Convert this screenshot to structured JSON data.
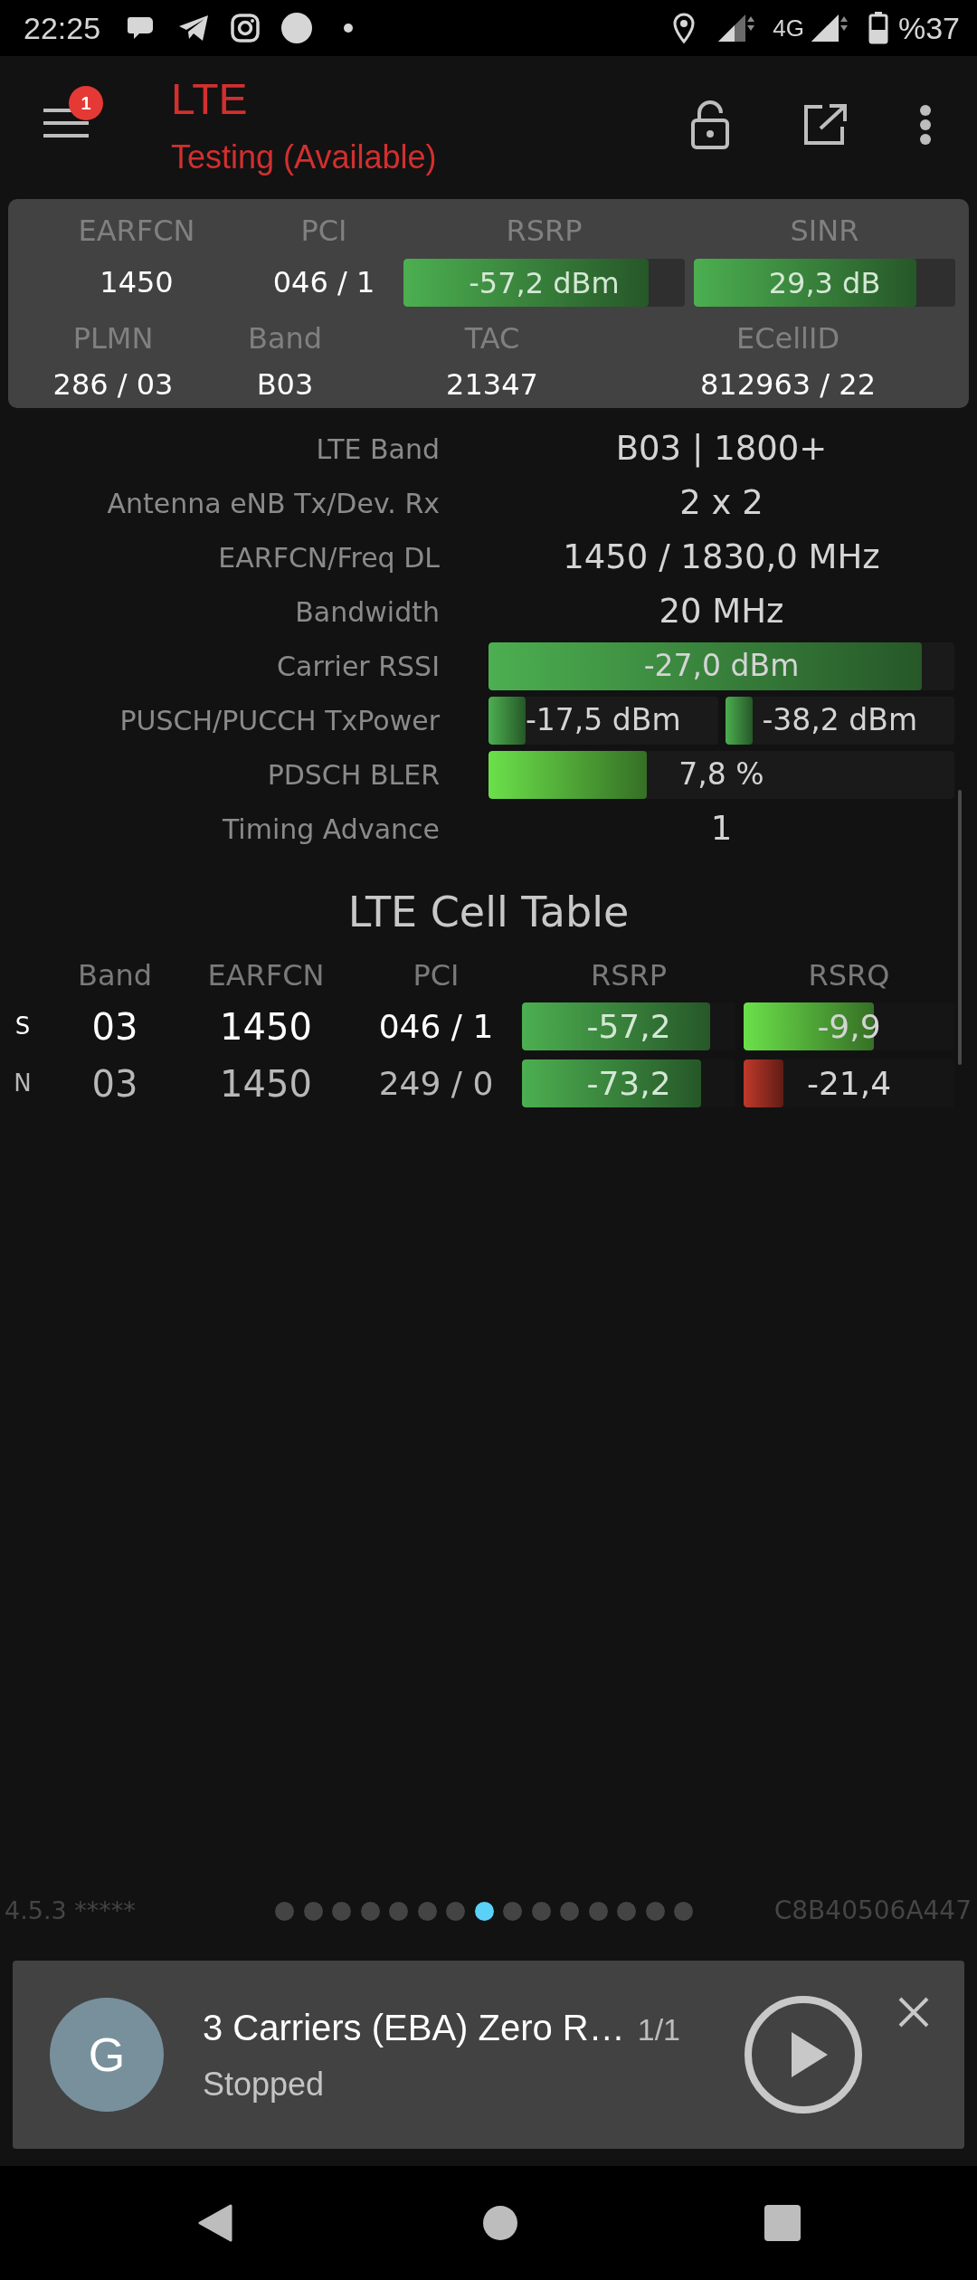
{
  "status_bar": {
    "time": "22:25",
    "network_type": "4G",
    "battery": "%37"
  },
  "app_bar": {
    "title": "LTE",
    "subtitle": "Testing (Available)",
    "menu_badge": "1"
  },
  "summary": {
    "row_1": [
      {
        "kind": "text",
        "label": "EARFCN",
        "value": "1450"
      },
      {
        "kind": "text",
        "label": "PCI",
        "value": "046 / 1"
      },
      {
        "kind": "bar",
        "label": "RSRP",
        "value": "-57,2 dBm",
        "level": 0.87,
        "color": "#4caf50"
      },
      {
        "kind": "bar",
        "label": "SINR",
        "value": "29,3 dB",
        "level": 0.85,
        "color": "#4caf50"
      }
    ],
    "row_2": [
      {
        "label": "PLMN",
        "value": "286 / 03"
      },
      {
        "label": "Band",
        "value": "B03"
      },
      {
        "label": "TAC",
        "value": "21347"
      },
      {
        "label": "ECellID",
        "value": "812963 / 22"
      }
    ]
  },
  "details": [
    {
      "kind": "text",
      "label": "LTE Band",
      "value": "B03 | 1800+"
    },
    {
      "kind": "text",
      "label": "Antenna eNB Tx/Dev. Rx",
      "value": "2 x 2"
    },
    {
      "kind": "text",
      "label": "EARFCN/Freq DL",
      "value": "1450 / 1830,0 MHz"
    },
    {
      "kind": "text",
      "label": "Bandwidth",
      "value": "20 MHz"
    },
    {
      "kind": "bars",
      "label": "Carrier RSSI",
      "bars": [
        {
          "value": "-27,0 dBm",
          "level": 0.93,
          "color": "#4caf50"
        }
      ]
    },
    {
      "kind": "bars",
      "label": "PUSCH/PUCCH TxPower",
      "bars": [
        {
          "value": "-17,5 dBm",
          "level": 0.16,
          "color": "#4caf50"
        },
        {
          "value": "-38,2 dBm",
          "level": 0.12,
          "color": "#4caf50"
        }
      ]
    },
    {
      "kind": "bars",
      "label": "PDSCH BLER",
      "bars": [
        {
          "value": "7,8 %",
          "level": 0.34,
          "color": "#6be04a"
        }
      ]
    },
    {
      "kind": "text",
      "label": "Timing Advance",
      "value": "1"
    }
  ],
  "cell_table": {
    "title": "LTE Cell Table",
    "columns": [
      "Band",
      "EARFCN",
      "PCI",
      "RSRP",
      "RSRQ"
    ],
    "rows": [
      {
        "type": "S",
        "serving": true,
        "band": "03",
        "earfcn": "1450",
        "pci": "046 / 1",
        "rsrp": {
          "value": "-57,2",
          "level": 0.88,
          "color": "#4caf50"
        },
        "rsrq": {
          "value": "-9,9",
          "level": 0.62,
          "color": "#6be04a"
        }
      },
      {
        "type": "N",
        "serving": false,
        "band": "03",
        "earfcn": "1450",
        "pci": "249 / 0",
        "rsrp": {
          "value": "-73,2",
          "level": 0.84,
          "color": "#4caf50"
        },
        "rsrq": {
          "value": "-21,4",
          "level": 0.19,
          "color": "#c0392b"
        }
      }
    ]
  },
  "footer": {
    "version": "4.5.3 *****",
    "device_id": "C8B40506A447"
  },
  "pager": {
    "dots": [
      {
        "selected": false
      },
      {
        "selected": false
      },
      {
        "selected": false
      },
      {
        "selected": false
      },
      {
        "selected": false
      },
      {
        "selected": false
      },
      {
        "selected": false
      },
      {
        "selected": true
      },
      {
        "selected": false
      },
      {
        "selected": false
      },
      {
        "selected": false
      },
      {
        "selected": false
      },
      {
        "selected": false
      },
      {
        "selected": false
      },
      {
        "selected": false
      }
    ]
  },
  "notification": {
    "avatar": "G",
    "title": "3 Carriers (EBA) Zero R…",
    "counter": "1/1",
    "status": "Stopped"
  }
}
